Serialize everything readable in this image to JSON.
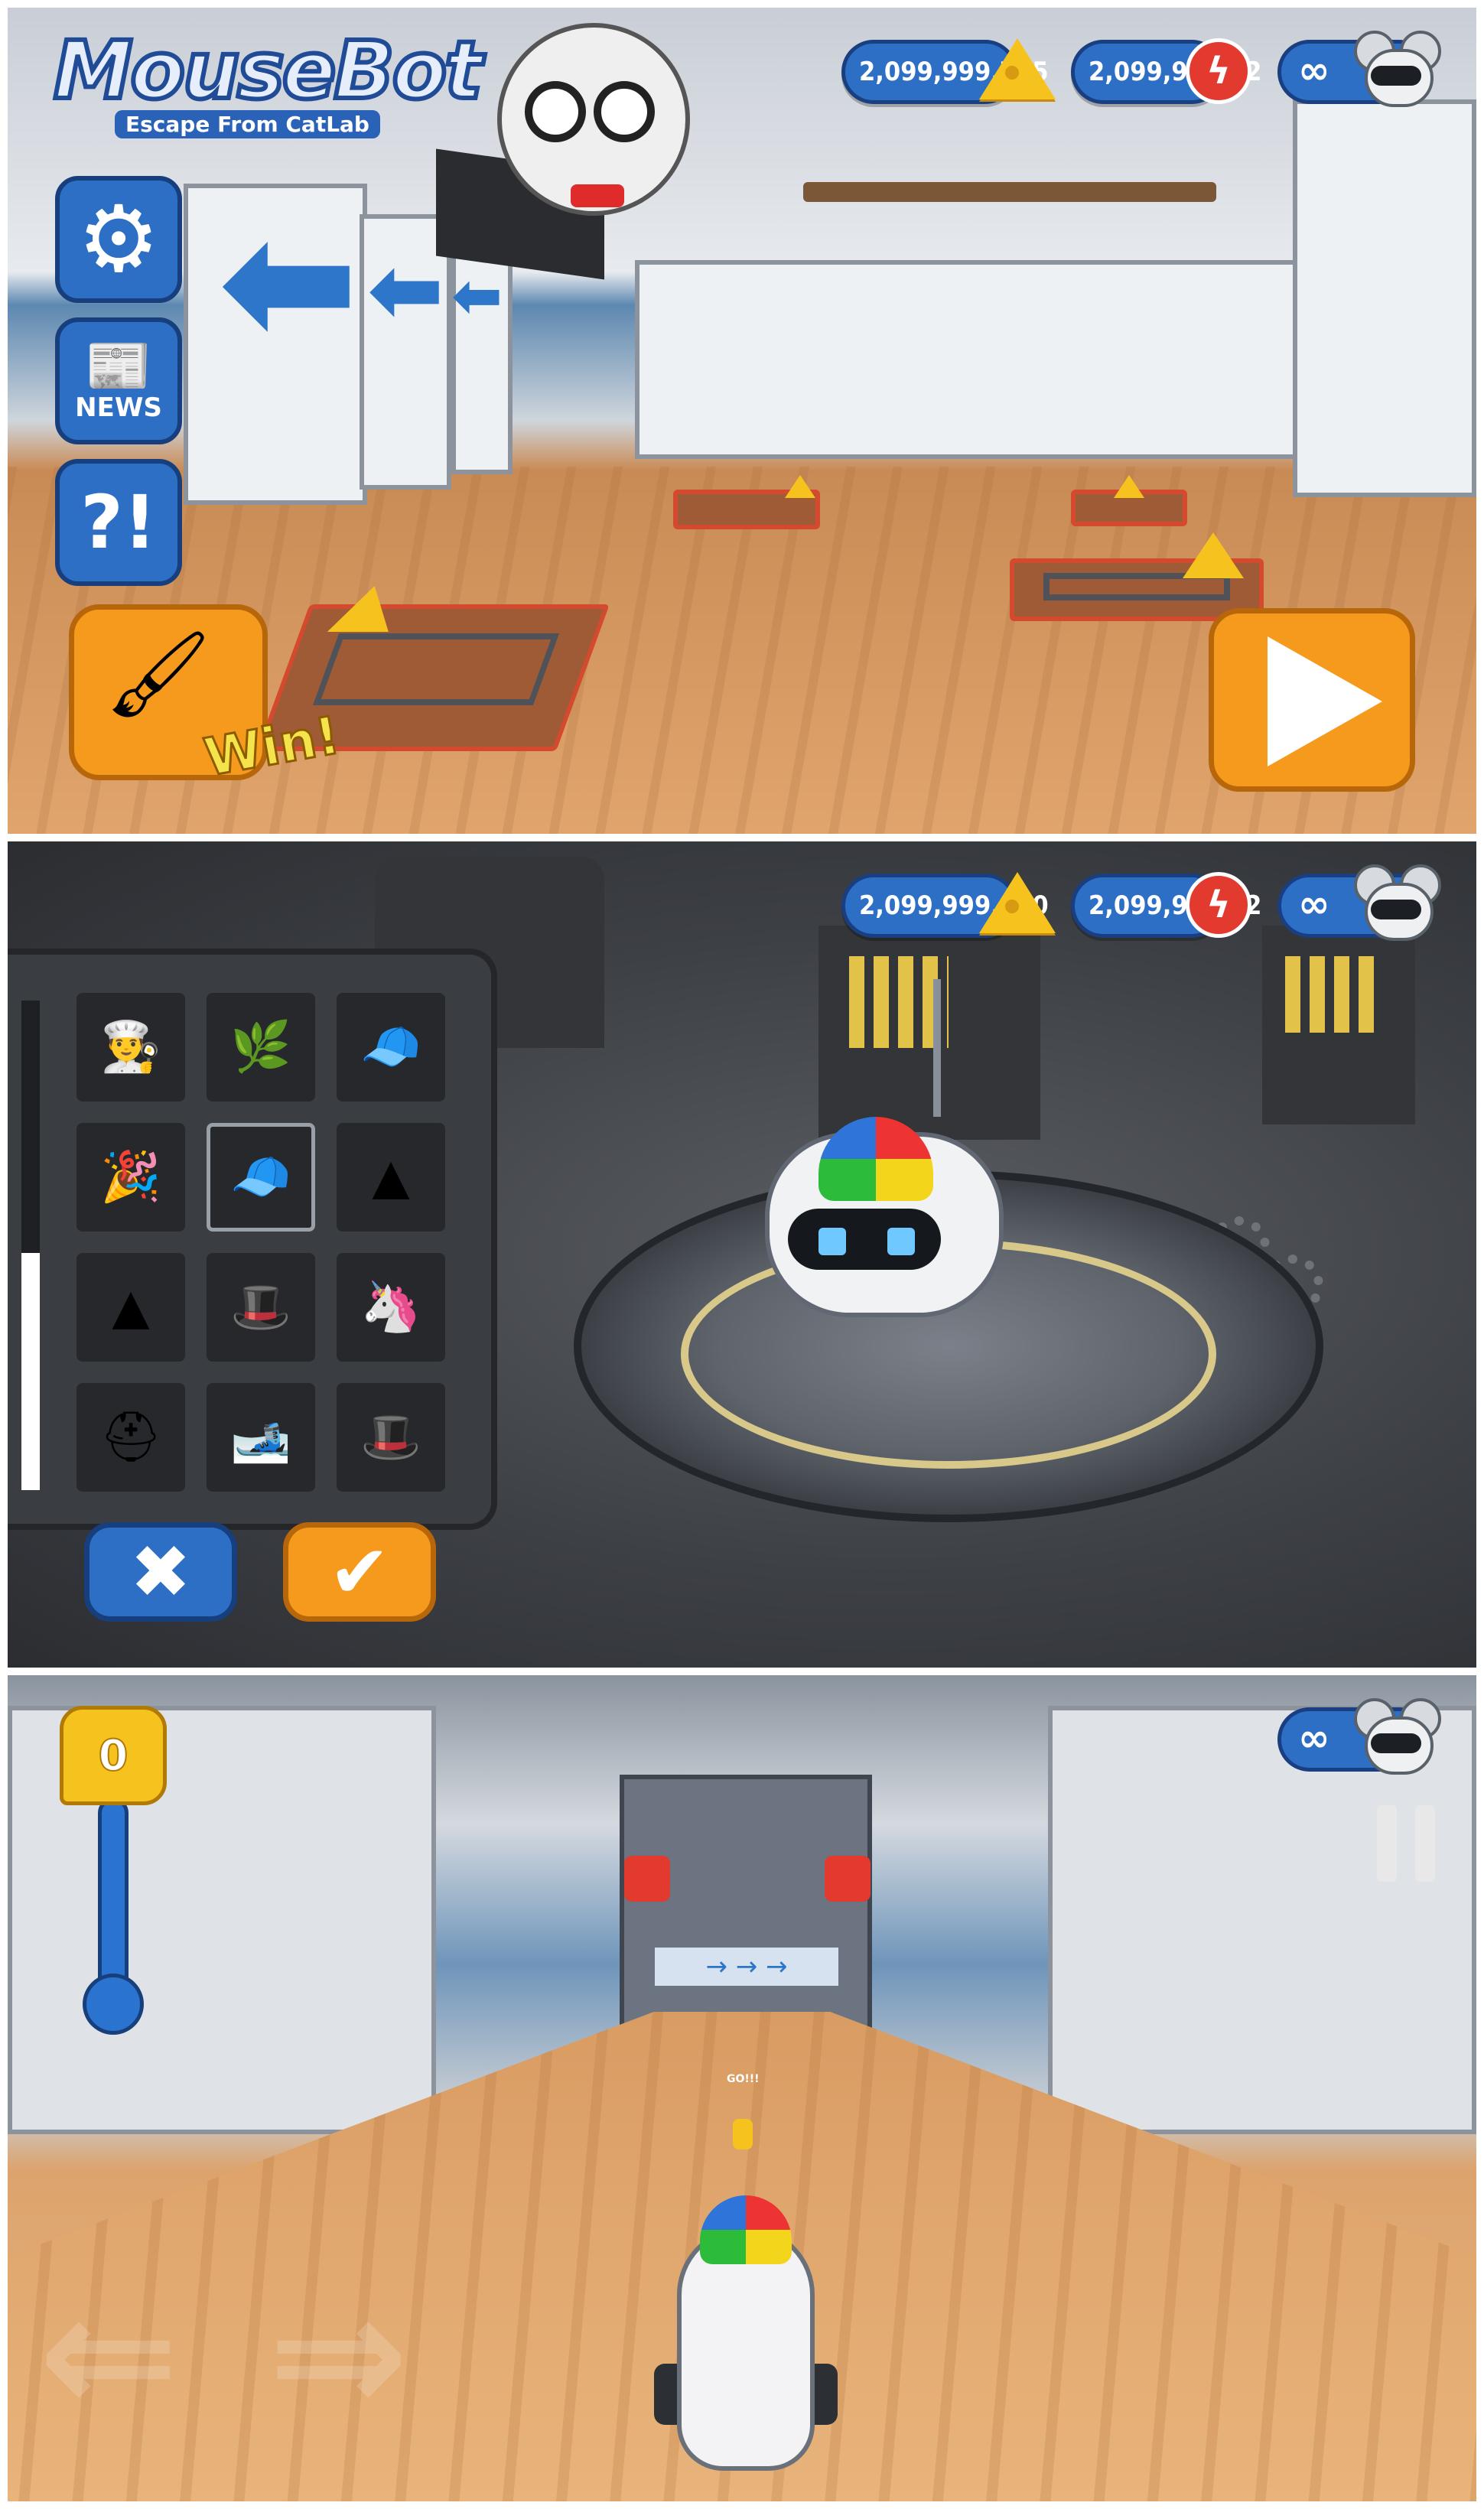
{
  "screen1": {
    "logo": {
      "title": "MouseBot",
      "subtitle": "Escape From CatLab"
    },
    "hud": {
      "cheese_count": "2,099,999,715",
      "energy_count": "2,099,998,62",
      "lives": "∞"
    },
    "side_buttons": {
      "news": "NEWS",
      "help": "?!"
    },
    "win_label": "Win!"
  },
  "screen2": {
    "hud": {
      "cheese_count": "2,099,999,670",
      "energy_count": "2,099,998,62",
      "lives": "∞"
    },
    "hats": [
      {
        "name": "chef-hat",
        "glyph": "👨‍🍳"
      },
      {
        "name": "leaf-crown",
        "glyph": "🌿"
      },
      {
        "name": "yellow-visor",
        "glyph": "🧢"
      },
      {
        "name": "party-hat",
        "glyph": "🎉"
      },
      {
        "name": "propeller-beanie",
        "glyph": "🧢",
        "selected": true
      },
      {
        "name": "silver-spikes",
        "glyph": "▲"
      },
      {
        "name": "dark-spikes",
        "glyph": "▲"
      },
      {
        "name": "striped-top-hat",
        "glyph": "🎩"
      },
      {
        "name": "unicorn-horn",
        "glyph": "🦄"
      },
      {
        "name": "viking-helmet",
        "glyph": "⛑"
      },
      {
        "name": "bobble-hat",
        "glyph": "🎿"
      },
      {
        "name": "black-top-hat",
        "glyph": "🎩"
      }
    ],
    "cancel_glyph": "✖",
    "confirm_glyph": "✔"
  },
  "screen3": {
    "cheese_meter_value": "0",
    "lives": "∞",
    "go_text": "GO!!!"
  },
  "colors": {
    "hud_blue": "#2d6fc4",
    "hud_border": "#1a3f80",
    "orange": "#f59a1c",
    "cheese": "#f6c21e",
    "energy_red": "#e23a2f"
  }
}
